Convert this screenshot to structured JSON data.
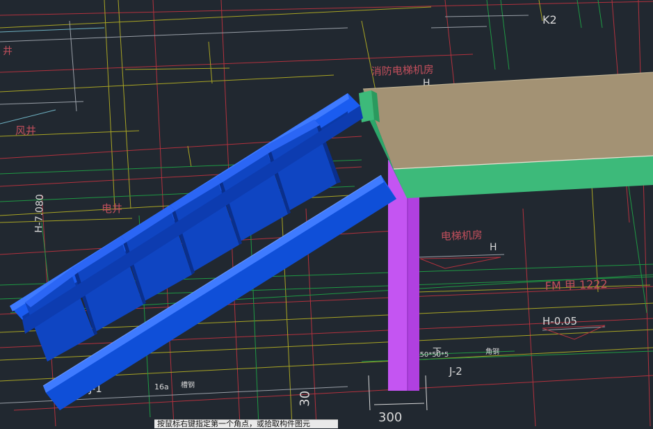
{
  "drawing_labels": {
    "grid_k2": "K2",
    "fire_elevator_room": "消防电梯机房",
    "fire_elevator_room_level": "H",
    "wind_shaft": "风井",
    "left_edge_label": "井",
    "electrical_shaft": "电井",
    "elevator_room": "电梯机房",
    "elevator_room_level": "H",
    "fire_door": "FM 甲 1222",
    "level_mark": "H-0.05",
    "angle_steel_spec": "L50*50*5",
    "angle_steel": "角钢",
    "down_arrow": "下",
    "foundation_j2": "J-2",
    "foundation_j1": "J-1",
    "channel_spec": "16a",
    "channel_steel": "槽钢",
    "dim_300": "300",
    "dim_30_rotated": "30",
    "rotated_level": "H-7.080"
  },
  "status_bar": {
    "prompt": "按鼠标右键指定第一个角点，或拾取构件图元"
  },
  "colors": {
    "background": "#212830",
    "stair_blue": "#1a5cf0",
    "slab_top": "#a39274",
    "slab_edge": "#3dba7a",
    "column_magenta": "#c455f2",
    "cad_red": "#c2404a",
    "cad_yellow": "#b3b028",
    "cad_green": "#2aa84a",
    "cad_white": "#d8d8d8"
  }
}
